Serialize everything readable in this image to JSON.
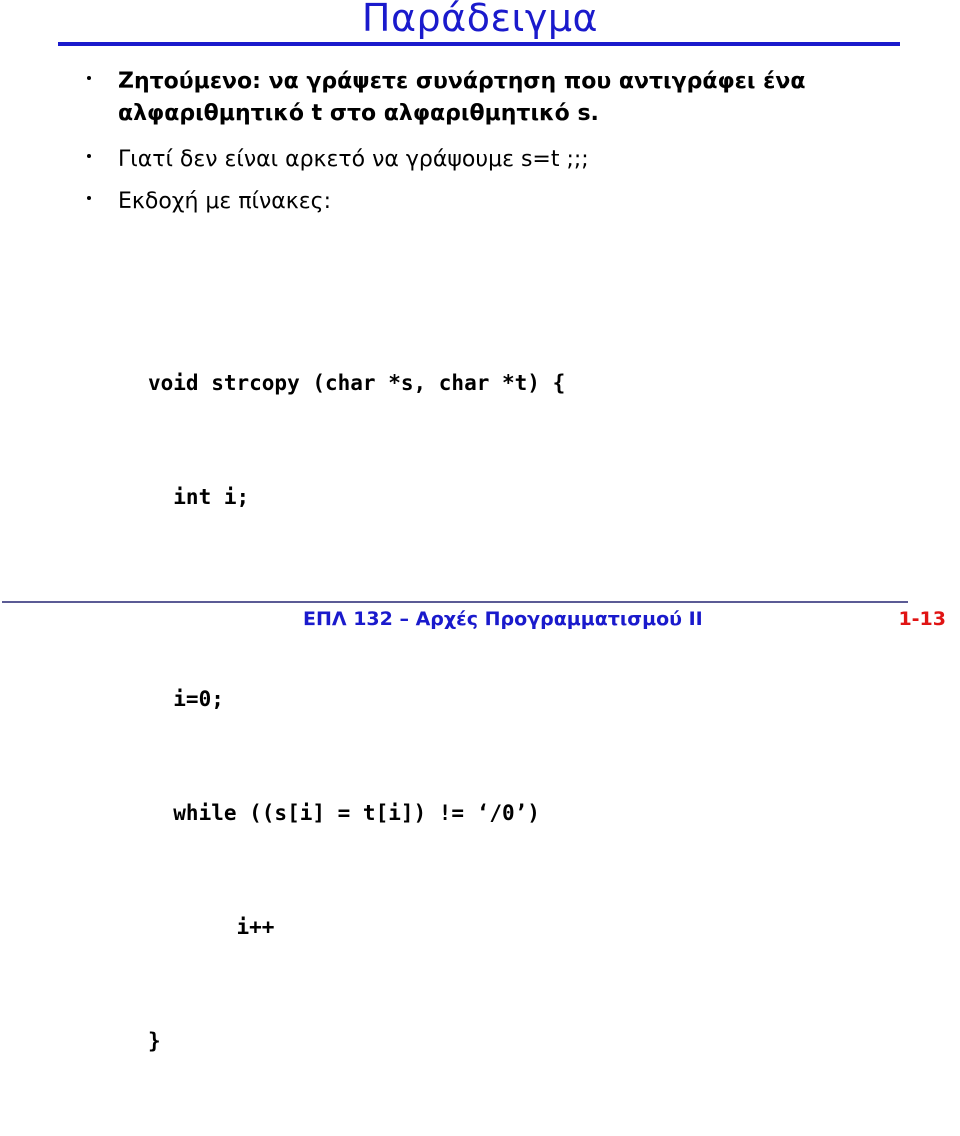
{
  "slide": {
    "title": "Παράδειγμα",
    "bullets": [
      {
        "marker": "bullet-dot",
        "text": "Ζητούμενο: να γράψετε συνάρτηση που αντιγράφει ένα αλφαριθμητικό t στο αλφαριθμητικό s."
      },
      {
        "marker": "bullet-dot",
        "text": "Γιατί δεν είναι αρκετό να γράψουμε s=t ;;;"
      },
      {
        "marker": "bullet-dot",
        "text": "Εκδοχή με πίνακες:"
      }
    ],
    "code": {
      "lines": [
        "void strcopy (char *s, char *t) {",
        "  int i;",
        "",
        "  i=0;",
        "  while ((s[i] = t[i]) != ‘/0’)",
        "       i++",
        "}"
      ]
    },
    "footer": {
      "course": "ΕΠΛ 132 – Αρχές Προγραμματισμού II",
      "page": "1-13"
    },
    "colors": {
      "title_blue": "#1a1acc",
      "rule_blue": "#1a1acc",
      "footer_rule": "#5b5b95",
      "footer_text": "#1a1acc",
      "page_number_red": "#e01414",
      "body_text": "#000000",
      "background": "#ffffff"
    }
  }
}
